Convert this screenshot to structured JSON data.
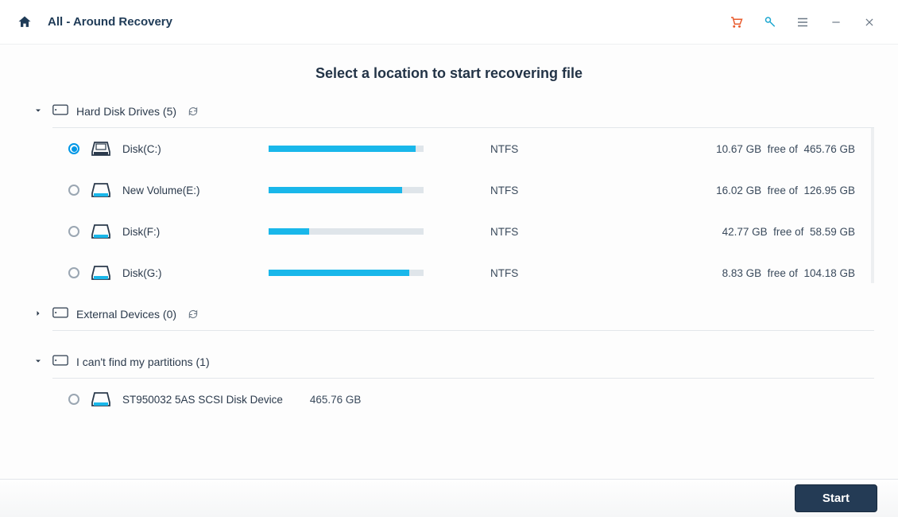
{
  "titlebar": {
    "title": "All - Around Recovery"
  },
  "heading": "Select a location to start recovering file",
  "groups": {
    "hdd": {
      "label": "Hard Disk Drives (5)",
      "expanded": true
    },
    "ext": {
      "label": "External Devices (0)",
      "expanded": false
    },
    "lost": {
      "label": "I can't find my partitions (1)",
      "expanded": true
    }
  },
  "drives": [
    {
      "name": "Disk(C:)",
      "fs": "NTFS",
      "free": "10.67  GB",
      "total": "465.76  GB",
      "pct": 95,
      "selected": true,
      "system": true
    },
    {
      "name": "New Volume(E:)",
      "fs": "NTFS",
      "free": "16.02  GB",
      "total": "126.95  GB",
      "pct": 86,
      "selected": false,
      "system": false
    },
    {
      "name": "Disk(F:)",
      "fs": "NTFS",
      "free": "42.77  GB",
      "total": "58.59  GB",
      "pct": 26,
      "selected": false,
      "system": false
    },
    {
      "name": "Disk(G:)",
      "fs": "NTFS",
      "free": "8.83  GB",
      "total": "104.18  GB",
      "pct": 91,
      "selected": false,
      "system": false
    }
  ],
  "lost_items": [
    {
      "name": "ST950032 5AS SCSI Disk Device",
      "size": "465.76  GB",
      "selected": false
    }
  ],
  "size_join": "free of",
  "footer": {
    "start": "Start"
  }
}
